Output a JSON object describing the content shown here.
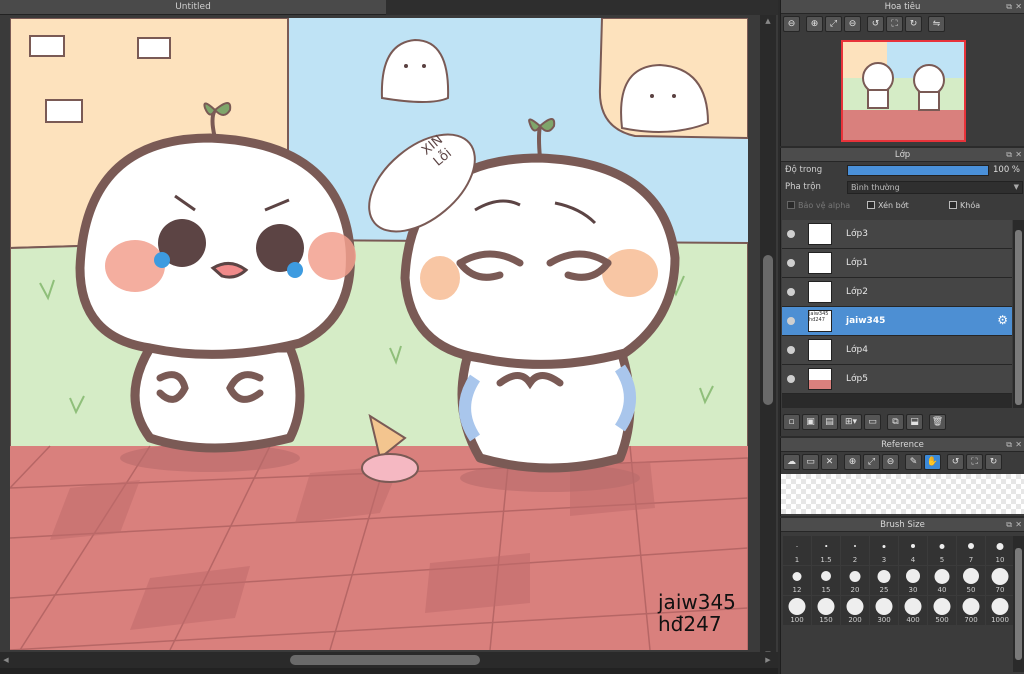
{
  "document": {
    "tab_title": "Untitled"
  },
  "artwork": {
    "speech_bubble_text": [
      "XIN",
      "Lỗi"
    ],
    "signature_lines": [
      "jaiw345",
      "hđ247"
    ]
  },
  "navigator": {
    "title": "Hoa tiêu",
    "toolbar_icons": [
      "zoom-out-icon",
      "zoom-in-icon",
      "fit-icon",
      "zoom-out-small-icon",
      "rotate-left-icon",
      "fit-screen-icon",
      "rotate-right-icon",
      "flip-icon"
    ]
  },
  "layer_panel": {
    "title": "Lớp",
    "opacity_label": "Độ trong",
    "opacity_value": "100 %",
    "opacity_fraction": 1.0,
    "blend_label": "Pha trộn",
    "blend_value": "Bình thường",
    "protect_alpha_label": "Bảo vệ alpha",
    "clipping_label": "Xén bớt",
    "lock_label": "Khóa",
    "layers": [
      {
        "name": "Lớp3",
        "selected": false
      },
      {
        "name": "Lớp1",
        "selected": false
      },
      {
        "name": "Lớp2",
        "selected": false
      },
      {
        "name": "jaiw345",
        "thumb_lines": [
          "jaiw345",
          "hđ247"
        ],
        "selected": true
      },
      {
        "name": "Lớp4",
        "selected": false
      },
      {
        "name": "Lớp5",
        "selected": false
      }
    ]
  },
  "reference_panel": {
    "title": "Reference"
  },
  "brush_panel": {
    "title": "Brush Size",
    "sizes": [
      "1",
      "1.5",
      "2",
      "3",
      "4",
      "5",
      "7",
      "10",
      "12",
      "15",
      "20",
      "25",
      "30",
      "40",
      "50",
      "70",
      "100",
      "150",
      "200",
      "300",
      "400",
      "500",
      "700",
      "1000"
    ]
  },
  "colors": {
    "accent": "#4d8fd3",
    "navigator_frame": "#e8333a",
    "floor": "#d9807d",
    "sky": "#bfe3f5"
  }
}
